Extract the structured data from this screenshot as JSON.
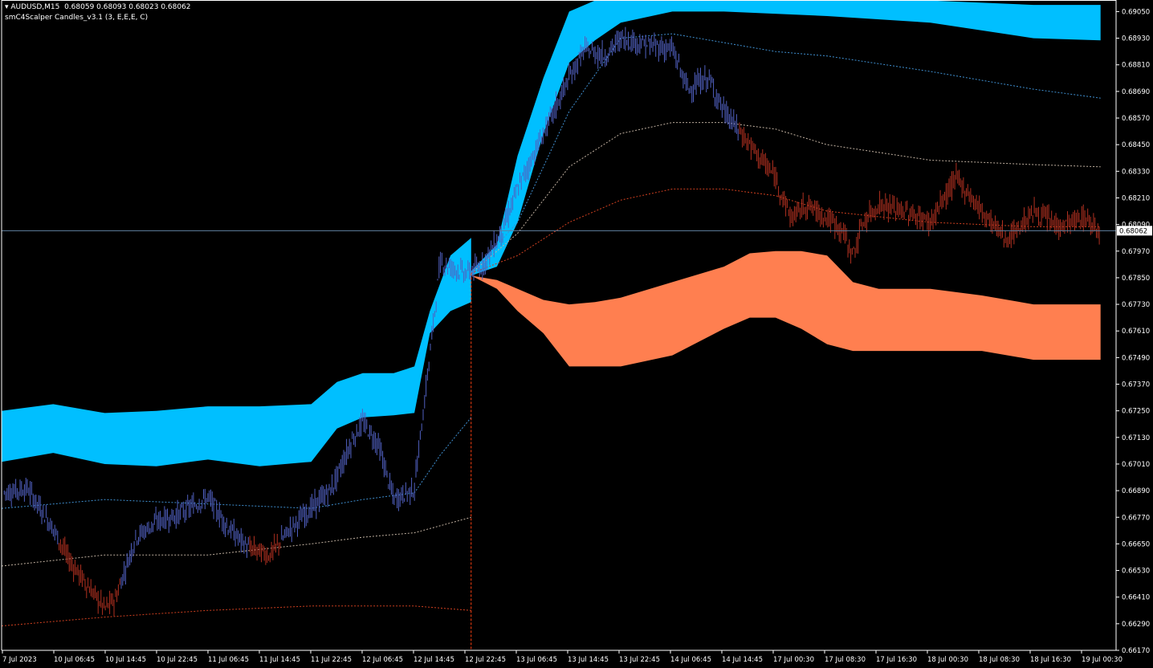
{
  "header": {
    "symbol_line": "▾ AUDUSD,M15  0.68059 0.68093 0.68023 0.68062",
    "indicator_line": "smC4Scalper Candles_v3.1 (3, E,E,E, C)"
  },
  "colors": {
    "background": "#000000",
    "bull_band": "#00BFFF",
    "bear_band": "#FF7F50",
    "bull_candle": "#5060C0",
    "bear_candle": "#B03020",
    "axis": "#FFFFFF",
    "crosshair": "#6080A0"
  },
  "price_tag": "0.68062",
  "chart_data": {
    "type": "candlestick",
    "symbol": "AUDUSD",
    "timeframe": "M15",
    "ohlc_last": {
      "open": 0.68059,
      "high": 0.68093,
      "low": 0.68023,
      "close": 0.68062
    },
    "current_price": 0.68062,
    "ylim": [
      0.6617,
      0.69095
    ],
    "y_ticks": [
      "0.69050",
      "0.68930",
      "0.68810",
      "0.68690",
      "0.68570",
      "0.68450",
      "0.68330",
      "0.68210",
      "0.68090",
      "0.67970",
      "0.67850",
      "0.67730",
      "0.67610",
      "0.67490",
      "0.67370",
      "0.67250",
      "0.67130",
      "0.67010",
      "0.66890",
      "0.66770",
      "0.66650",
      "0.66530",
      "0.66410",
      "0.66290",
      "0.66170"
    ],
    "x_ticks": [
      "7 Jul 2023",
      "10 Jul 06:45",
      "10 Jul 14:45",
      "10 Jul 22:45",
      "11 Jul 06:45",
      "11 Jul 14:45",
      "11 Jul 22:45",
      "12 Jul 06:45",
      "12 Jul 14:45",
      "12 Jul 22:45",
      "13 Jul 06:45",
      "13 Jul 14:45",
      "13 Jul 22:45",
      "14 Jul 06:45",
      "14 Jul 14:45",
      "17 Jul 00:30",
      "17 Jul 08:30",
      "17 Jul 16:30",
      "18 Jul 00:30",
      "18 Jul 08:30",
      "18 Jul 16:30",
      "19 Jul 00:30"
    ],
    "price_path": [
      {
        "x": 0,
        "y": 0.6688
      },
      {
        "x": 0.5,
        "y": 0.669
      },
      {
        "x": 1,
        "y": 0.6672
      },
      {
        "x": 1.3,
        "y": 0.6658
      },
      {
        "x": 1.7,
        "y": 0.6645
      },
      {
        "x": 2,
        "y": 0.6636
      },
      {
        "x": 2.2,
        "y": 0.664
      },
      {
        "x": 2.6,
        "y": 0.6668
      },
      {
        "x": 3,
        "y": 0.6675
      },
      {
        "x": 3.4,
        "y": 0.6678
      },
      {
        "x": 3.7,
        "y": 0.6682
      },
      {
        "x": 4,
        "y": 0.6686
      },
      {
        "x": 4.4,
        "y": 0.6672
      },
      {
        "x": 4.8,
        "y": 0.6663
      },
      {
        "x": 5.2,
        "y": 0.666
      },
      {
        "x": 5.6,
        "y": 0.6672
      },
      {
        "x": 6,
        "y": 0.6681
      },
      {
        "x": 6.4,
        "y": 0.669
      },
      {
        "x": 6.8,
        "y": 0.6712
      },
      {
        "x": 7,
        "y": 0.672
      },
      {
        "x": 7.3,
        "y": 0.671
      },
      {
        "x": 7.6,
        "y": 0.6685
      },
      {
        "x": 8,
        "y": 0.669
      },
      {
        "x": 8.2,
        "y": 0.673
      },
      {
        "x": 8.5,
        "y": 0.6792
      },
      {
        "x": 9,
        "y": 0.6787
      },
      {
        "x": 9.3,
        "y": 0.679
      },
      {
        "x": 9.7,
        "y": 0.6806
      },
      {
        "x": 10,
        "y": 0.6825
      },
      {
        "x": 10.5,
        "y": 0.685
      },
      {
        "x": 11,
        "y": 0.6875
      },
      {
        "x": 11.3,
        "y": 0.6888
      },
      {
        "x": 11.7,
        "y": 0.6885
      },
      {
        "x": 12,
        "y": 0.6893
      },
      {
        "x": 12.5,
        "y": 0.689
      },
      {
        "x": 13,
        "y": 0.6888
      },
      {
        "x": 13.3,
        "y": 0.687
      },
      {
        "x": 13.7,
        "y": 0.6875
      },
      {
        "x": 14,
        "y": 0.686
      },
      {
        "x": 14.5,
        "y": 0.6845
      },
      {
        "x": 15,
        "y": 0.683
      },
      {
        "x": 15.3,
        "y": 0.6812
      },
      {
        "x": 15.6,
        "y": 0.6818
      },
      {
        "x": 16,
        "y": 0.6812
      },
      {
        "x": 16.3,
        "y": 0.6806
      },
      {
        "x": 16.5,
        "y": 0.6795
      },
      {
        "x": 16.7,
        "y": 0.681
      },
      {
        "x": 17,
        "y": 0.6818
      },
      {
        "x": 17.5,
        "y": 0.6815
      },
      {
        "x": 18,
        "y": 0.681
      },
      {
        "x": 18.5,
        "y": 0.683
      },
      {
        "x": 19,
        "y": 0.6815
      },
      {
        "x": 19.5,
        "y": 0.6802
      },
      {
        "x": 20,
        "y": 0.6815
      },
      {
        "x": 20.5,
        "y": 0.6808
      },
      {
        "x": 21,
        "y": 0.6812
      },
      {
        "x": 21.3,
        "y": 0.6806
      }
    ],
    "bull_band": {
      "x": [
        0,
        1,
        2,
        3,
        4,
        5,
        6,
        6.5,
        7,
        7.6,
        8,
        8.3,
        8.7,
        9.1,
        9.1
      ],
      "upper": [
        0.6725,
        0.6728,
        0.6724,
        0.6725,
        0.6727,
        0.6727,
        0.6728,
        0.6738,
        0.6742,
        0.6742,
        0.6745,
        0.677,
        0.6795,
        0.6803,
        0.6803
      ],
      "lower": [
        0.6702,
        0.6706,
        0.6701,
        0.67,
        0.6703,
        0.67,
        0.6702,
        0.6717,
        0.6722,
        0.6723,
        0.6724,
        0.676,
        0.677,
        0.6774,
        0.6774
      ]
    },
    "bull_band_2": {
      "x": [
        9.1,
        9.6,
        10,
        10.5,
        11,
        11.5,
        12,
        13,
        14,
        16,
        18,
        20,
        21.3
      ],
      "upper": [
        0.6788,
        0.68,
        0.684,
        0.6875,
        0.6905,
        0.691,
        0.691,
        0.691,
        0.691,
        0.691,
        0.691,
        0.6908,
        0.6908
      ],
      "lower": [
        0.6786,
        0.679,
        0.681,
        0.685,
        0.6882,
        0.6892,
        0.69,
        0.6905,
        0.6905,
        0.6903,
        0.69,
        0.6893,
        0.6892
      ]
    },
    "bear_band": {
      "x": [
        9.1,
        9.6,
        10,
        10.5,
        11,
        11.5,
        12,
        13,
        14,
        14.5,
        15,
        15.5,
        16,
        16.5,
        17,
        18,
        19,
        20,
        21.3
      ],
      "upper": [
        0.6786,
        0.6784,
        0.678,
        0.6775,
        0.6773,
        0.6774,
        0.6776,
        0.6783,
        0.679,
        0.6796,
        0.6797,
        0.6797,
        0.6795,
        0.6783,
        0.678,
        0.678,
        0.6777,
        0.6773,
        0.6773
      ],
      "lower": [
        0.6786,
        0.678,
        0.677,
        0.676,
        0.6745,
        0.6745,
        0.6745,
        0.675,
        0.6762,
        0.6767,
        0.6767,
        0.6762,
        0.6755,
        0.6752,
        0.6752,
        0.6752,
        0.6752,
        0.6748,
        0.6748
      ]
    },
    "dotted_lines": [
      {
        "color": "#3F8FD0",
        "x": [
          0,
          2,
          4,
          6,
          7,
          8,
          8.5,
          9.1
        ],
        "y": [
          0.6681,
          0.6685,
          0.6683,
          0.6681,
          0.6685,
          0.6688,
          0.6705,
          0.6722
        ]
      },
      {
        "color": "#3F8FD0",
        "x": [
          9.1,
          10,
          11,
          12,
          13,
          14,
          15,
          16,
          18,
          20,
          21.3
        ],
        "y": [
          0.6787,
          0.681,
          0.686,
          0.6893,
          0.6895,
          0.6891,
          0.6887,
          0.6885,
          0.6878,
          0.687,
          0.6866
        ]
      },
      {
        "color": "#C0B0A0",
        "x": [
          0,
          2,
          4,
          6,
          7,
          8,
          9.1
        ],
        "y": [
          0.6655,
          0.666,
          0.666,
          0.6665,
          0.6668,
          0.667,
          0.6677
        ]
      },
      {
        "color": "#C0B0A0",
        "x": [
          9.1,
          10,
          11,
          12,
          13,
          14,
          15,
          16,
          18,
          20,
          21.3
        ],
        "y": [
          0.6787,
          0.6805,
          0.6835,
          0.685,
          0.6855,
          0.6855,
          0.6852,
          0.6845,
          0.6838,
          0.6836,
          0.6835
        ]
      },
      {
        "color": "#D04020",
        "x": [
          0,
          2,
          4,
          6,
          7,
          8,
          9.1
        ],
        "y": [
          0.6628,
          0.6632,
          0.6635,
          0.6637,
          0.6637,
          0.6637,
          0.6635
        ]
      },
      {
        "color": "#D04020",
        "x": [
          9.1,
          10,
          11,
          12,
          13,
          14,
          15,
          16,
          18,
          20,
          21.3
        ],
        "y": [
          0.6787,
          0.6795,
          0.681,
          0.682,
          0.6825,
          0.6825,
          0.6822,
          0.6815,
          0.681,
          0.6808,
          0.6808
        ]
      }
    ],
    "separator_x": 9.1,
    "grid": false,
    "legend": "none"
  }
}
